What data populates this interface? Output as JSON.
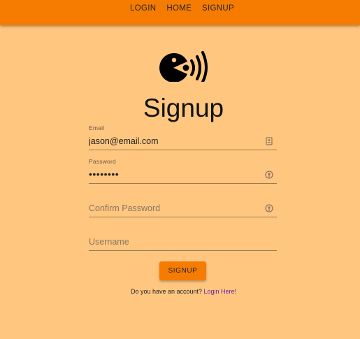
{
  "nav": {
    "items": [
      {
        "label": "LOGIN"
      },
      {
        "label": "HOME"
      },
      {
        "label": "SIGNUP"
      }
    ]
  },
  "logo": {
    "icon": "chomping-face-sound-waves-logo"
  },
  "page": {
    "title": "Signup"
  },
  "form": {
    "email": {
      "label": "Email",
      "value": "jason@email.com",
      "icon": "contact-card-icon"
    },
    "password": {
      "label": "Password",
      "value": "••••••••",
      "icon": "key-icon"
    },
    "confirm_password": {
      "placeholder": "Confirm Password",
      "icon": "key-icon"
    },
    "username": {
      "placeholder": "Username"
    },
    "submit_label": "SIGNUP"
  },
  "footer": {
    "text": "Do you have an account?",
    "link": "Login Here!"
  },
  "colors": {
    "background": "#ffc680",
    "topbar": "#f57c00",
    "button": "#f57c00",
    "link": "#6a1fa0"
  }
}
